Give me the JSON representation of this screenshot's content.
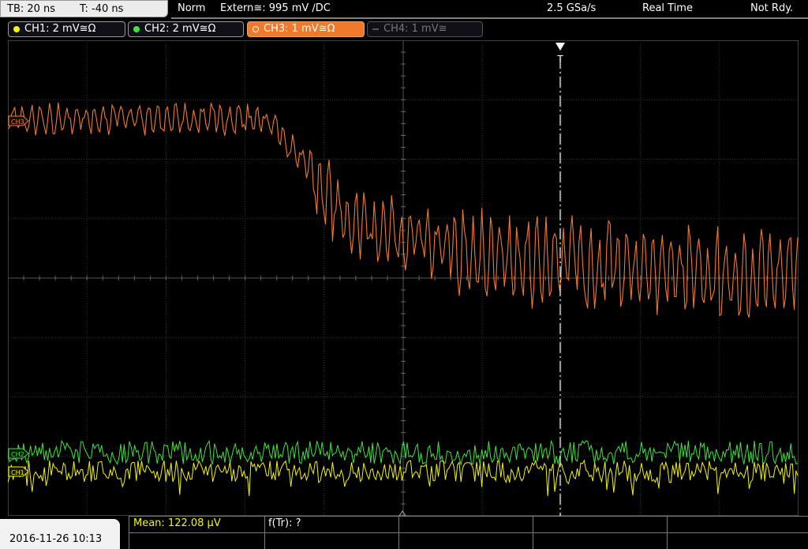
{
  "topbar": {
    "timebase": "TB: 20 ns",
    "trigger_time": "T: -40 ns",
    "mode": "Norm",
    "trigger_source": "Extern≅: 995 mV ∕DC",
    "sample_rate": "2.5 GSa/s",
    "acq_mode": "Real Time",
    "status": "Not Rdy."
  },
  "channels": [
    {
      "label": "CH1: 2 mV≅Ω",
      "color": "#f5f500",
      "state": "on"
    },
    {
      "label": "CH2: 2 mV≅Ω",
      "color": "#3ce63c",
      "state": "on"
    },
    {
      "label": "CH3: 1 mV≅Ω",
      "color": "#f07a2a",
      "state": "active"
    },
    {
      "label": "CH4: 1 mV≅",
      "color": "#777777",
      "state": "off"
    }
  ],
  "markers": {
    "ch3": "CH3",
    "ch2": "CH2",
    "ch1": "CH1",
    "trigger": "T"
  },
  "measurements": {
    "mean": "Mean: 122.08 µV",
    "rise": "f(Tr): ?"
  },
  "datetime": "2016-11-26 10:13",
  "colors": {
    "ch1": "#f5f500",
    "ch2": "#3ce63c",
    "ch3": "#f07a2a",
    "grid": "#404040"
  }
}
